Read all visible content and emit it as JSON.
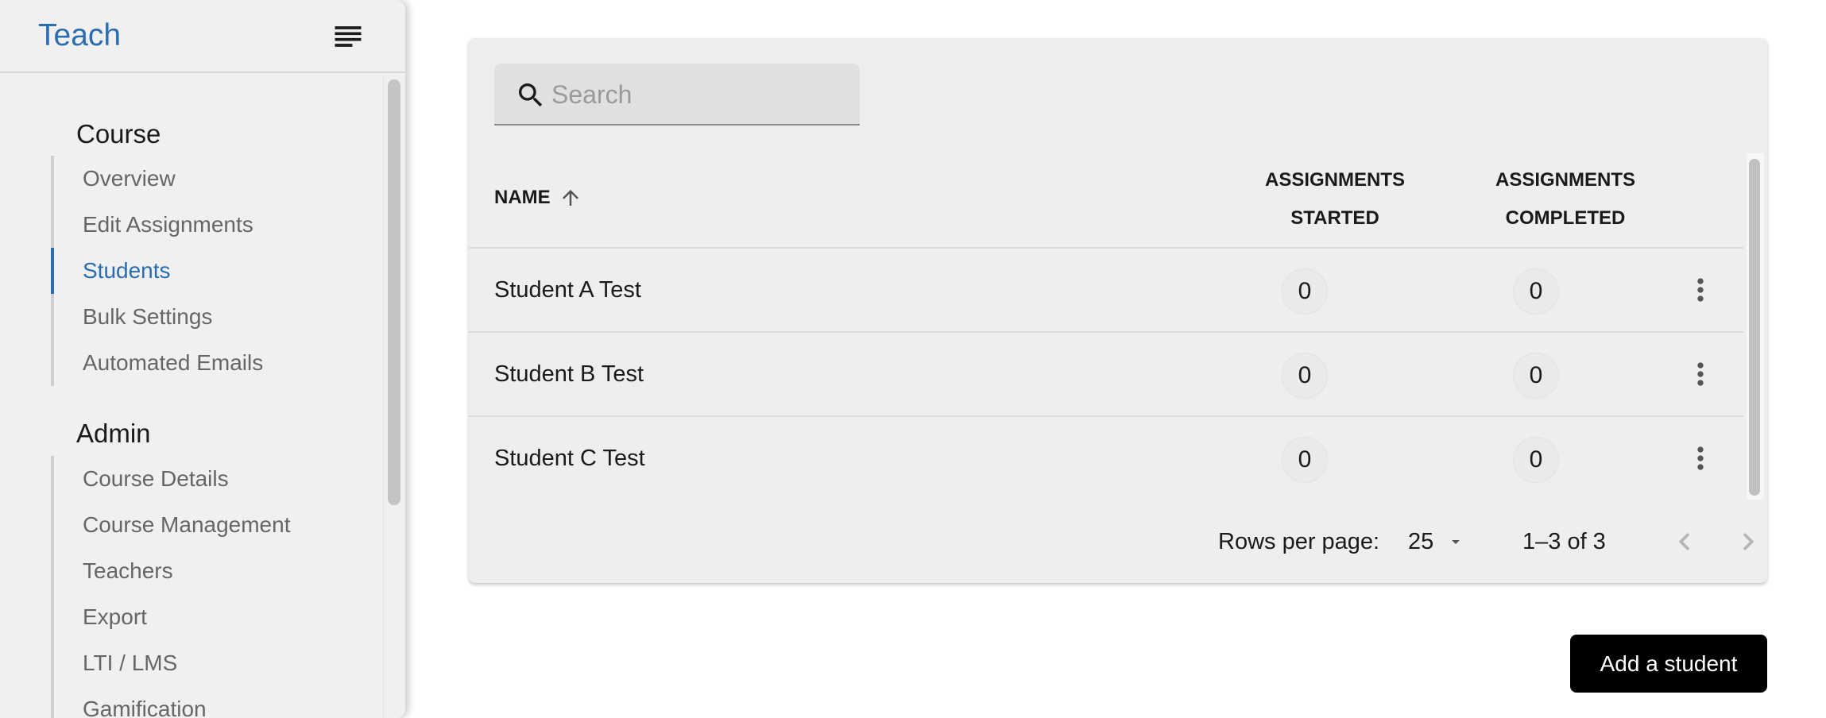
{
  "app": {
    "title": "Teach"
  },
  "sidebar": {
    "menu_icon": "menu-lines-icon",
    "sections": [
      {
        "title": "Course",
        "items": [
          {
            "label": "Overview",
            "active": false
          },
          {
            "label": "Edit Assignments",
            "active": false
          },
          {
            "label": "Students",
            "active": true
          },
          {
            "label": "Bulk Settings",
            "active": false
          },
          {
            "label": "Automated Emails",
            "active": false
          }
        ]
      },
      {
        "title": "Admin",
        "items": [
          {
            "label": "Course Details",
            "active": false
          },
          {
            "label": "Course Management",
            "active": false
          },
          {
            "label": "Teachers",
            "active": false
          },
          {
            "label": "Export",
            "active": false
          },
          {
            "label": "LTI / LMS",
            "active": false
          },
          {
            "label": "Gamification",
            "active": false
          }
        ]
      }
    ]
  },
  "search": {
    "placeholder": "Search",
    "value": ""
  },
  "table": {
    "columns": {
      "name": "Name",
      "started_line1": "Assignments",
      "started_line2": "Started",
      "completed_line1": "Assignments",
      "completed_line2": "Completed"
    },
    "sort": {
      "column": "name",
      "direction": "ascending"
    },
    "rows": [
      {
        "name": "Student A Test",
        "started": "0",
        "completed": "0"
      },
      {
        "name": "Student B Test",
        "started": "0",
        "completed": "0"
      },
      {
        "name": "Student C Test",
        "started": "0",
        "completed": "0"
      }
    ]
  },
  "pagination": {
    "rows_per_page_label": "Rows per page:",
    "rows_per_page": "25",
    "range": "1–3 of 3"
  },
  "actions": {
    "add_student": "Add a student"
  },
  "colors": {
    "accent": "#2a6db0",
    "sidebar_bg": "#f0f0f0",
    "card_bg": "#eeeeee",
    "primary_button": "#000000"
  }
}
